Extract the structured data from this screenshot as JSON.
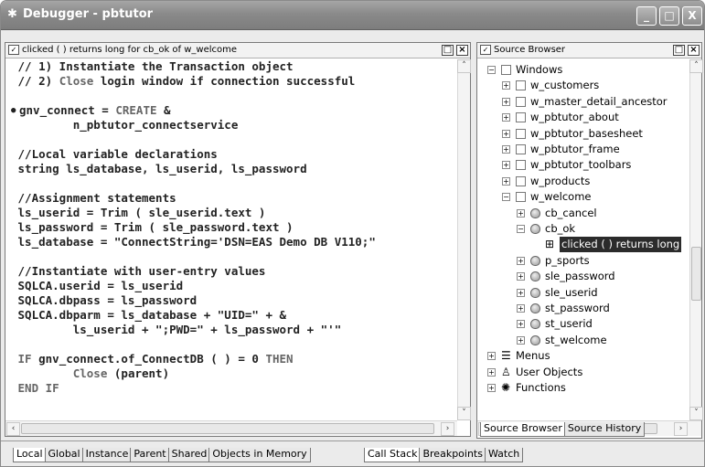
{
  "window": {
    "title": "Debugger - pbtutor",
    "controls": {
      "minimize": "_",
      "maximize": "□",
      "close": "X"
    }
  },
  "source_pane": {
    "title": "clicked ( ) returns long for cb_ok of w_welcome",
    "lines": [
      " // 1) Instantiate the Transaction object",
      " // 2) Close login window if connection successful",
      "",
      "gnv_connect = CREATE &",
      "         n_pbtutor_connectservice",
      "",
      " //Local variable declarations",
      " string ls_database, ls_userid, ls_password",
      "",
      " //Assignment statements",
      " ls_userid = Trim ( sle_userid.text )",
      " ls_password = Trim ( sle_password.text )",
      " ls_database = \"ConnectString='DSN=EAS Demo DB V110;\"",
      "",
      " //Instantiate with user-entry values",
      " SQLCA.userid = ls_userid",
      " SQLCA.dbpass = ls_password",
      " SQLCA.dbparm = ls_database + \"UID=\" + &",
      "         ls_userid + \";PWD=\" + ls_password + \"'\"",
      "",
      " IF gnv_connect.of_ConnectDB ( ) = 0 THEN",
      "         Close (parent)",
      " END IF"
    ],
    "breakpoint_marker": "●"
  },
  "source_browser": {
    "title": "Source Browser",
    "tree": [
      {
        "label": "Windows",
        "expander": "−",
        "icon": "window-icon"
      },
      {
        "label": "w_customers",
        "expander": "+",
        "icon": "window-icon"
      },
      {
        "label": "w_master_detail_ancestor",
        "expander": "+",
        "icon": "window-icon"
      },
      {
        "label": "w_pbtutor_about",
        "expander": "+",
        "icon": "window-icon"
      },
      {
        "label": "w_pbtutor_basesheet",
        "expander": "+",
        "icon": "window-icon"
      },
      {
        "label": "w_pbtutor_frame",
        "expander": "+",
        "icon": "window-icon"
      },
      {
        "label": "w_pbtutor_toolbars",
        "expander": "+",
        "icon": "window-icon"
      },
      {
        "label": "w_products",
        "expander": "+",
        "icon": "window-icon"
      },
      {
        "label": "w_welcome",
        "expander": "−",
        "icon": "window-icon"
      },
      {
        "label": "cb_cancel",
        "expander": "+",
        "icon": "control-icon"
      },
      {
        "label": "cb_ok",
        "expander": "−",
        "icon": "control-icon"
      },
      {
        "label": "clicked ( ) returns long",
        "expander": "",
        "icon": "event-icon"
      },
      {
        "label": "p_sports",
        "expander": "+",
        "icon": "control-icon"
      },
      {
        "label": "sle_password",
        "expander": "+",
        "icon": "control-icon"
      },
      {
        "label": "sle_userid",
        "expander": "+",
        "icon": "control-icon"
      },
      {
        "label": "st_password",
        "expander": "+",
        "icon": "control-icon"
      },
      {
        "label": "st_userid",
        "expander": "+",
        "icon": "control-icon"
      },
      {
        "label": "st_welcome",
        "expander": "+",
        "icon": "control-icon"
      },
      {
        "label": "Menus",
        "expander": "+",
        "icon": "menu-icon"
      },
      {
        "label": "User Objects",
        "expander": "+",
        "icon": "user-object-icon"
      },
      {
        "label": "Functions",
        "expander": "+",
        "icon": "function-icon"
      }
    ],
    "tabs": [
      "Source Browser",
      "Source History"
    ]
  },
  "bottom_left_tabs": [
    "Local",
    "Global",
    "Instance",
    "Parent",
    "Shared",
    "Objects in Memory"
  ],
  "bottom_right_tabs": [
    "Call Stack",
    "Breakpoints",
    "Watch"
  ]
}
